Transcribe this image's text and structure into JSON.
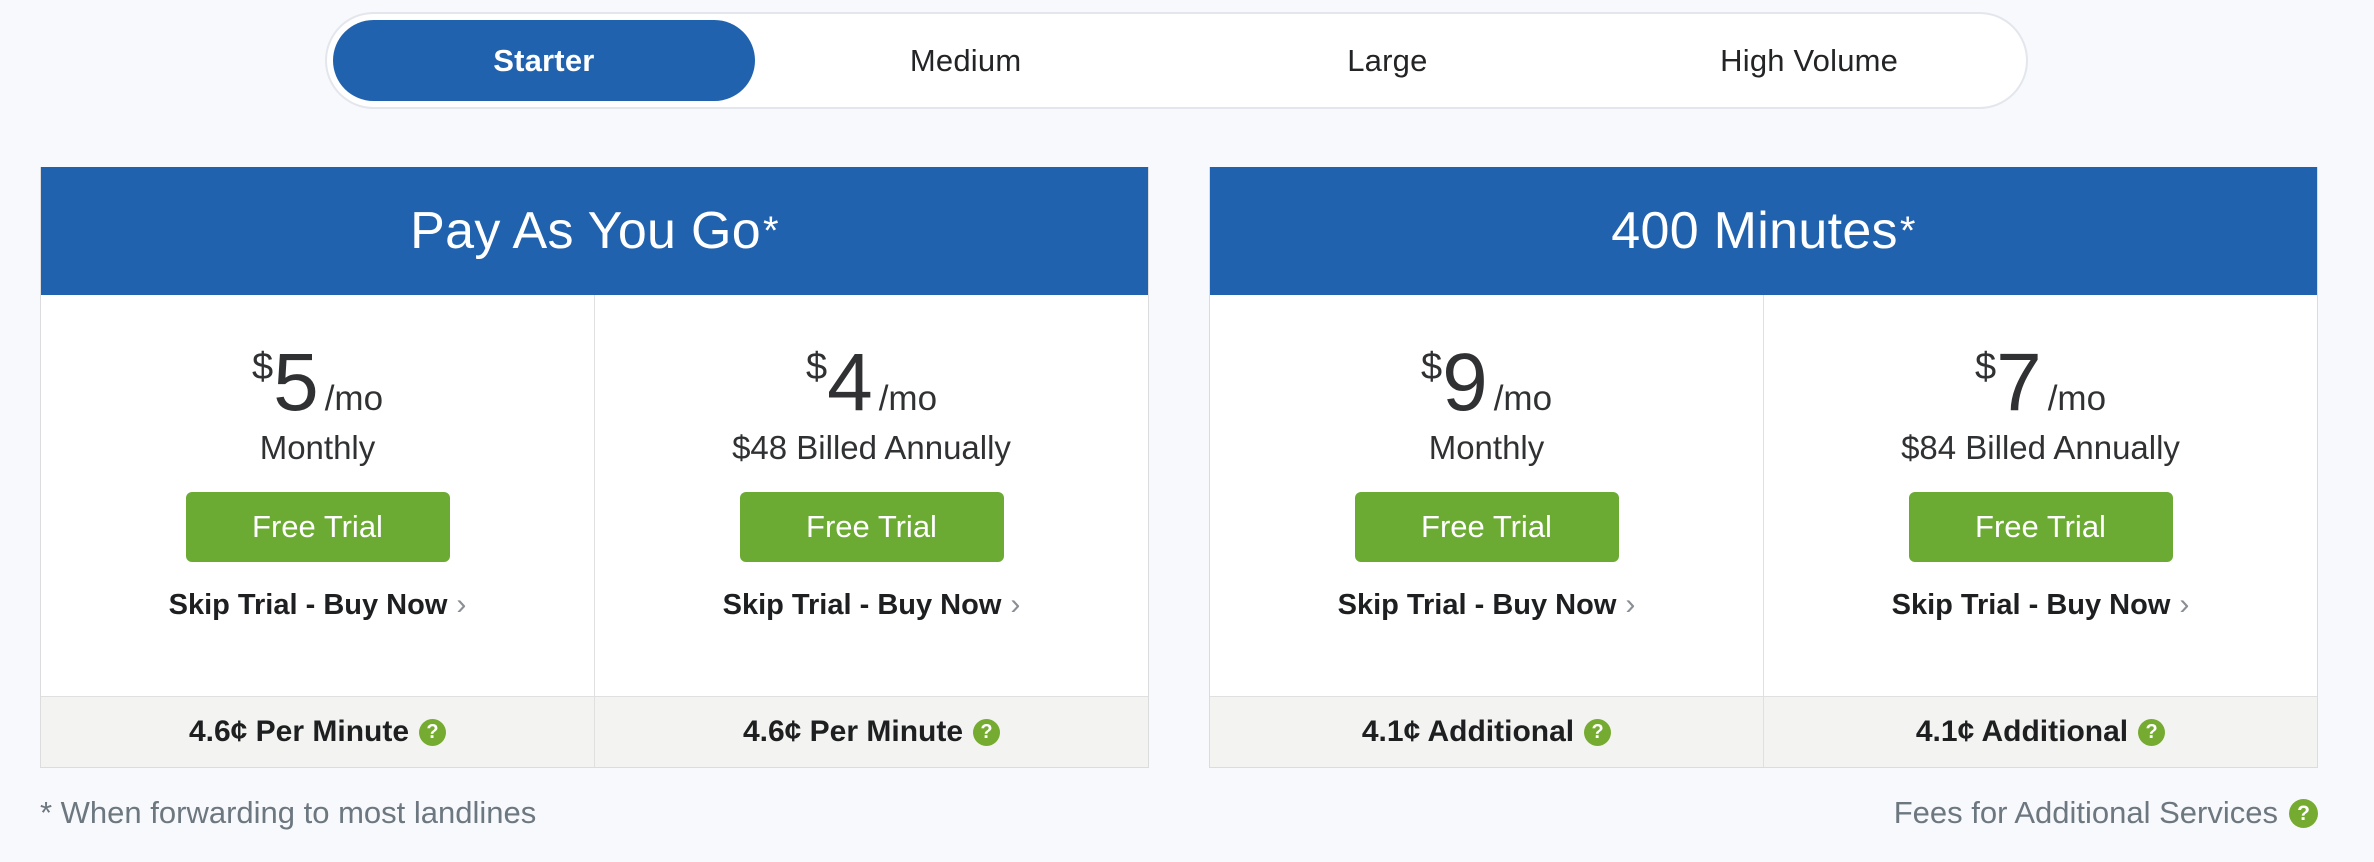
{
  "plan_toggle": {
    "tabs": [
      {
        "label": "Starter",
        "active": true
      },
      {
        "label": "Medium",
        "active": false
      },
      {
        "label": "Large",
        "active": false
      },
      {
        "label": "High Volume",
        "active": false
      }
    ]
  },
  "colors": {
    "brand_blue": "#2162ae",
    "accent_green": "#6cab33",
    "help_green": "#76ab31",
    "page_bg": "#f7f9fc",
    "rate_row_bg": "#f3f3f1"
  },
  "cards": [
    {
      "title": "Pay As You Go",
      "title_footnote_marker": "*",
      "columns": [
        {
          "currency": "$",
          "amount": "5",
          "per": "/mo",
          "billing_note": "Monthly",
          "cta_label": "Free Trial",
          "buy_now_label": "Skip Trial - Buy Now",
          "buy_now_chevron": "›",
          "rate_label": "4.6¢ Per Minute",
          "rate_help_icon": "help-icon"
        },
        {
          "currency": "$",
          "amount": "4",
          "per": "/mo",
          "billing_note": "$48 Billed Annually",
          "cta_label": "Free Trial",
          "buy_now_label": "Skip Trial - Buy Now",
          "buy_now_chevron": "›",
          "rate_label": "4.6¢ Per Minute",
          "rate_help_icon": "help-icon"
        }
      ]
    },
    {
      "title": "400 Minutes",
      "title_footnote_marker": "*",
      "columns": [
        {
          "currency": "$",
          "amount": "9",
          "per": "/mo",
          "billing_note": "Monthly",
          "cta_label": "Free Trial",
          "buy_now_label": "Skip Trial - Buy Now",
          "buy_now_chevron": "›",
          "rate_label": "4.1¢ Additional",
          "rate_help_icon": "help-icon"
        },
        {
          "currency": "$",
          "amount": "7",
          "per": "/mo",
          "billing_note": "$84 Billed Annually",
          "cta_label": "Free Trial",
          "buy_now_label": "Skip Trial - Buy Now",
          "buy_now_chevron": "›",
          "rate_label": "4.1¢ Additional",
          "rate_help_icon": "help-icon"
        }
      ]
    }
  ],
  "footnotes": {
    "left": "* When forwarding to most landlines",
    "right": "Fees for Additional Services",
    "right_help_icon": "help-icon",
    "help_glyph": "?"
  }
}
